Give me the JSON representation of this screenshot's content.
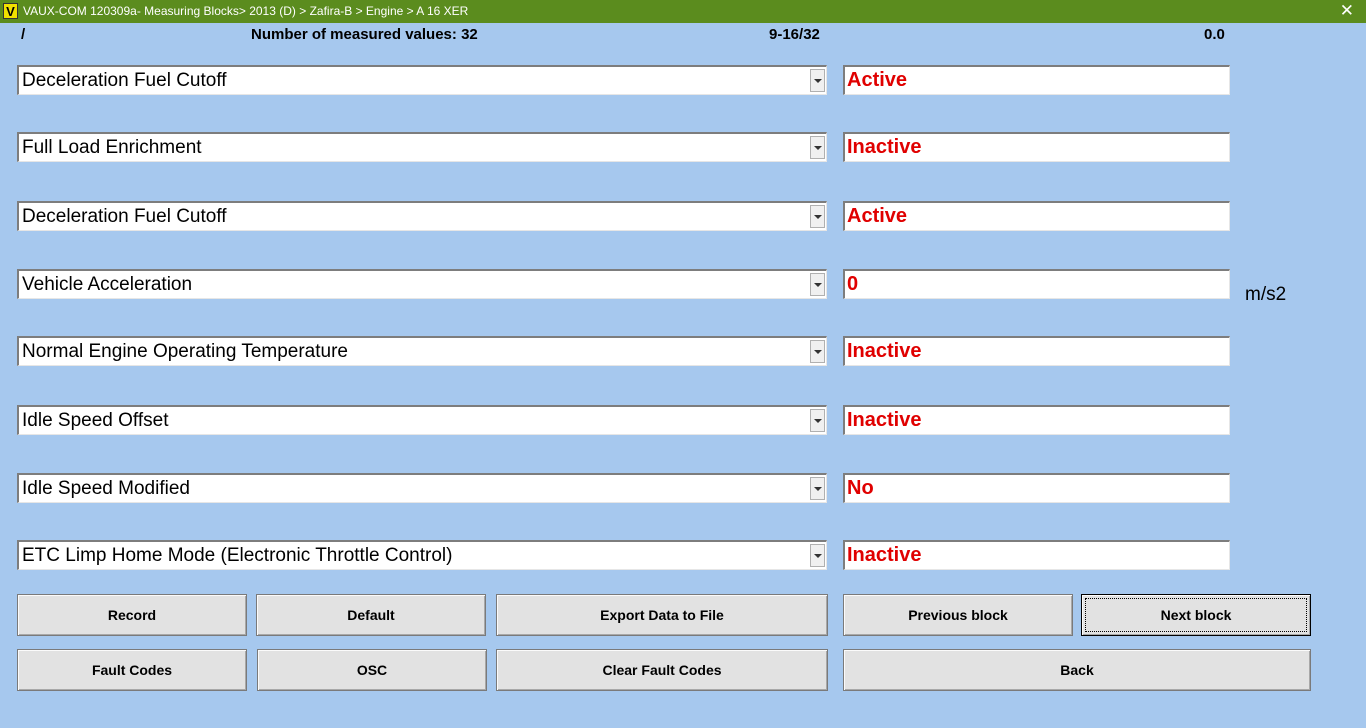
{
  "window": {
    "logo": "V",
    "title": "VAUX-COM 120309a- Measuring Blocks> 2013 (D) > Zafira-B > Engine > A 16 XER",
    "close": "✕"
  },
  "info": {
    "slash": "/",
    "count_label": "Number of measured values: 32",
    "range": "9-16/32",
    "value": "0.0"
  },
  "rows": [
    {
      "label": "Deceleration Fuel Cutoff",
      "value": "Active",
      "unit": ""
    },
    {
      "label": "Full Load Enrichment",
      "value": "Inactive",
      "unit": ""
    },
    {
      "label": "Deceleration Fuel Cutoff",
      "value": "Active",
      "unit": ""
    },
    {
      "label": "Vehicle Acceleration",
      "value": "0",
      "unit": "m/s2"
    },
    {
      "label": "Normal Engine Operating Temperature",
      "value": "Inactive",
      "unit": ""
    },
    {
      "label": "Idle Speed Offset",
      "value": "Inactive",
      "unit": ""
    },
    {
      "label": "Idle Speed Modified",
      "value": "No",
      "unit": ""
    },
    {
      "label": "ETC Limp Home Mode (Electronic Throttle Control)",
      "value": "Inactive",
      "unit": ""
    }
  ],
  "buttons": {
    "record": "Record",
    "default": "Default",
    "export": "Export Data to File",
    "previous": "Previous block",
    "next": "Next block",
    "fault_codes": "Fault Codes",
    "osc": "OSC",
    "clear_fault_codes": "Clear Fault Codes",
    "back": "Back"
  },
  "colors": {
    "background": "#a6c8ee",
    "titlebar": "#5b8c1e",
    "value_text": "#e00000"
  }
}
